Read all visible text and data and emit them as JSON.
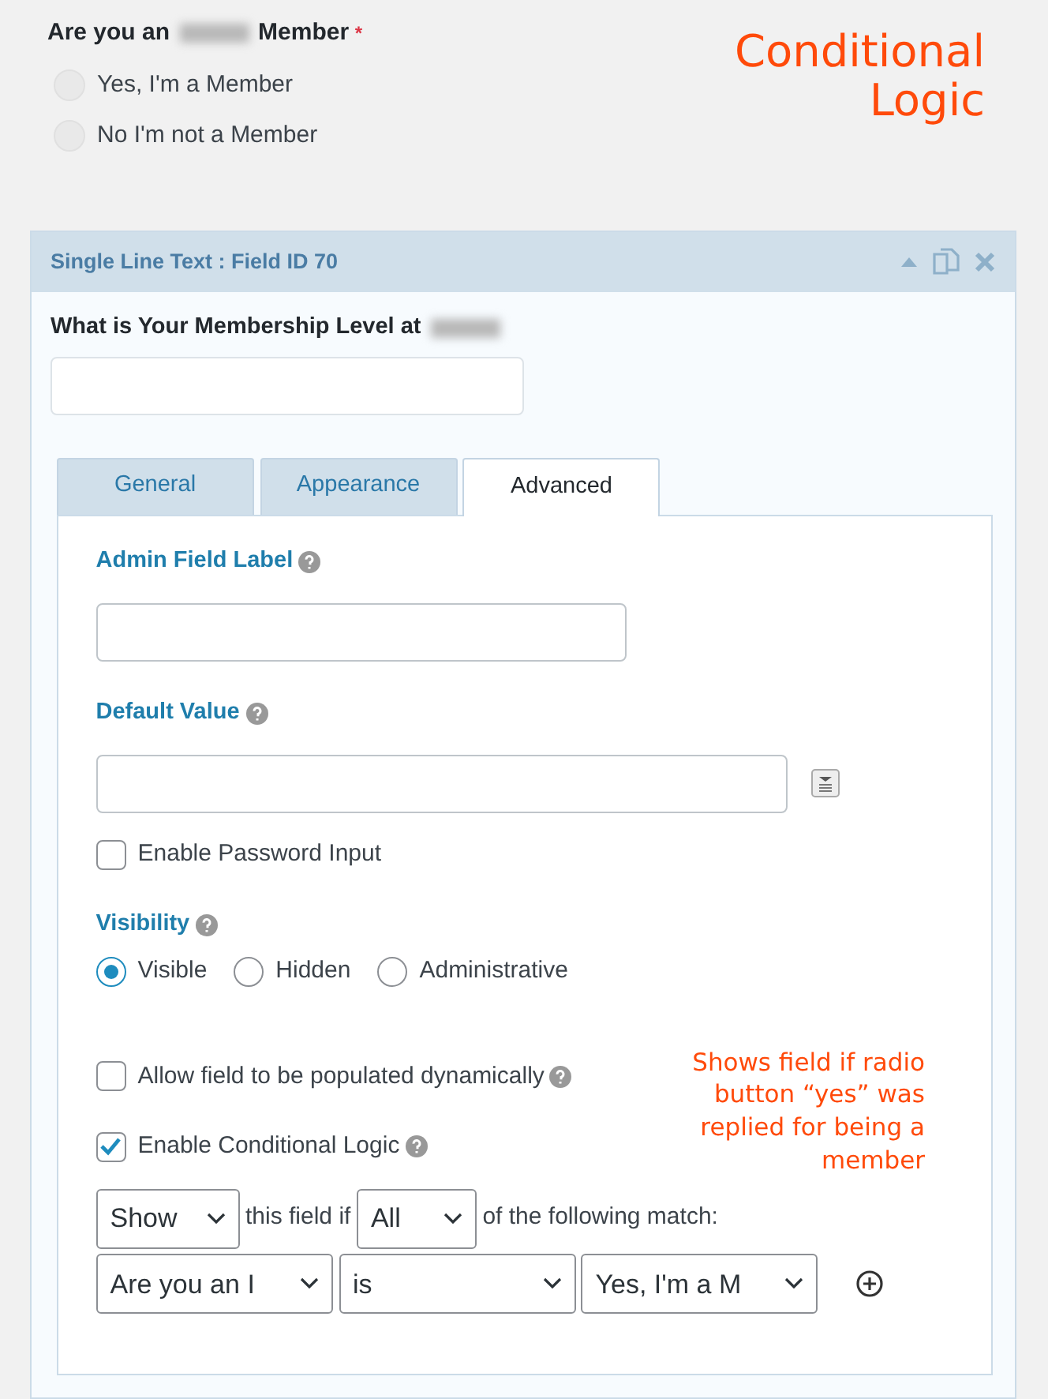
{
  "question": {
    "label_before": "Are you an",
    "label_after": "Member",
    "required_mark": "*",
    "options": [
      {
        "label": "Yes, I'm a Member",
        "selected": false
      },
      {
        "label": "No I'm not a Member",
        "selected": false
      }
    ]
  },
  "annotation_title": "Conditional Logic",
  "panel": {
    "title": "Single Line Text : Field ID 70",
    "field_label": "What is Your Membership Level at",
    "tabs": [
      {
        "label": "General",
        "selected": false
      },
      {
        "label": "Appearance",
        "selected": false
      },
      {
        "label": "Advanced",
        "selected": true
      }
    ],
    "admin_field_label": "Admin Field Label",
    "default_value": "Default Value",
    "password": {
      "label": "Enable Password Input",
      "checked": false
    },
    "visibility": {
      "label": "Visibility",
      "options": [
        {
          "label": "Visible",
          "selected": true
        },
        {
          "label": "Hidden",
          "selected": false
        },
        {
          "label": "Administrative",
          "selected": false
        }
      ]
    },
    "dynamic": {
      "label": "Allow field to be populated dynamically",
      "checked": false
    },
    "conditional": {
      "label": "Enable Conditional Logic",
      "checked": true
    },
    "annotation_note": "Shows field if radio button “yes” was replied for being a member",
    "logic": {
      "action": "Show",
      "text_1": "this field if",
      "match": "All",
      "text_2": "of the following match:",
      "rule": {
        "field": "Are you an I",
        "operator": "is",
        "value": "Yes, I'm a M"
      }
    }
  }
}
